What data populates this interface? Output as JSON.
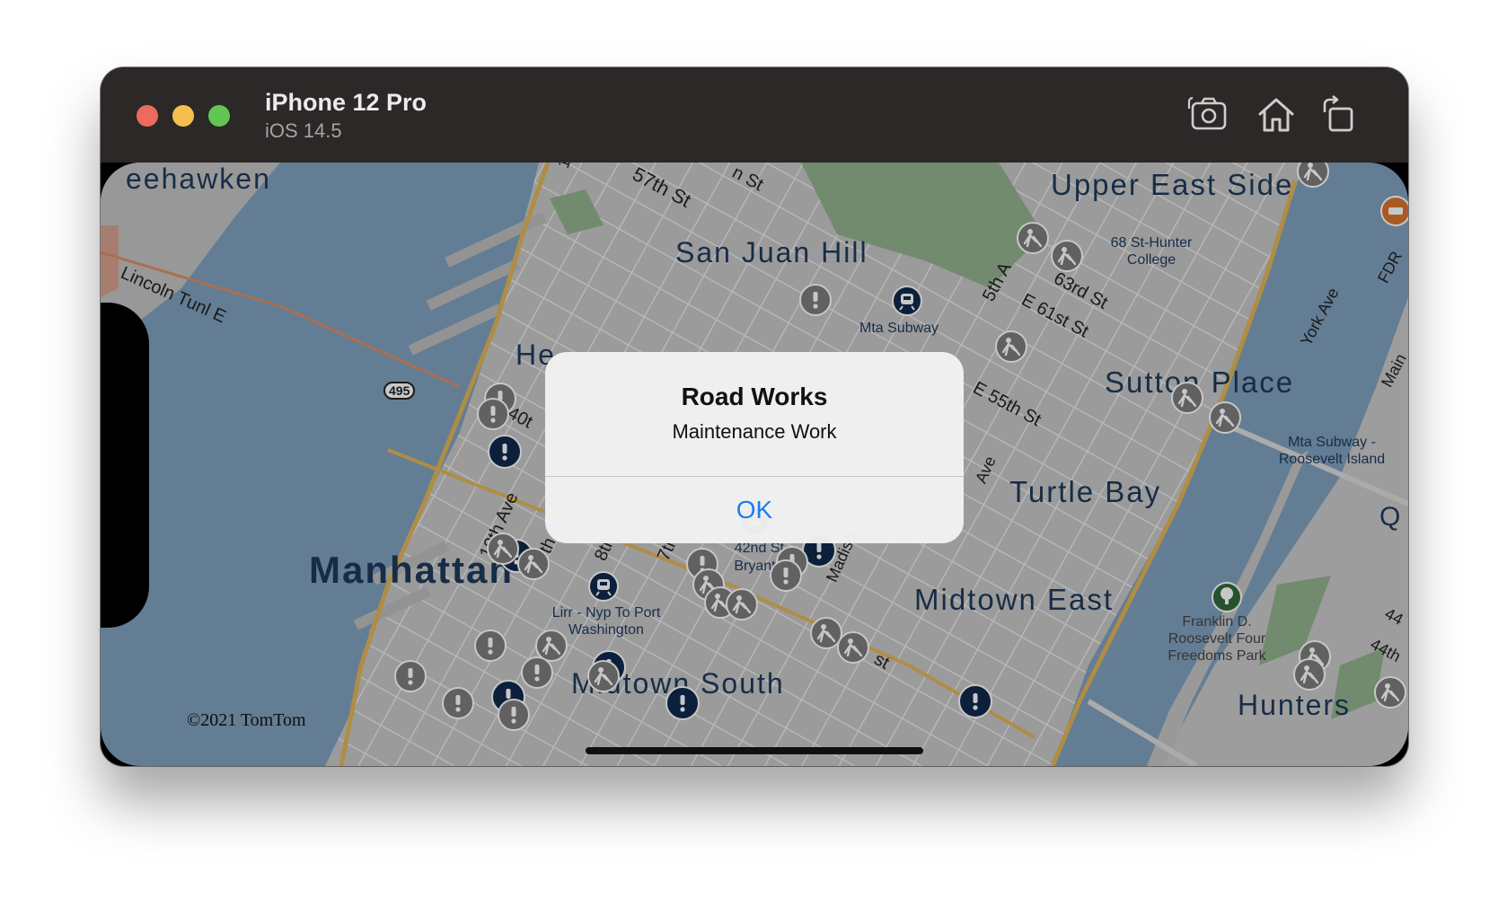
{
  "window": {
    "device_name": "iPhone 12 Pro",
    "os_version": "iOS 14.5"
  },
  "toolbar": {
    "icons": [
      "screenshot-camera-icon",
      "home-icon",
      "rotate-icon"
    ]
  },
  "map": {
    "copyright": "©2021 TomTom",
    "labels": {
      "weehawken": "eehawken",
      "lincoln_tunnel": "Lincoln Tunl E",
      "route_495": "495",
      "st_57th": "57th St",
      "st_12": "12",
      "st_top": "n St",
      "san_juan_hill": "San Juan Hill",
      "upper_east_side": "Upper East Side",
      "hunter_college": "68 St-Hunter College",
      "fifth_ave": "5th A",
      "st_63rd": "63rd St",
      "e_61st": "E 61st St",
      "mta_subway": "Mta Subway",
      "york_ave": "York Ave",
      "fdr": "FDR",
      "main": "Main",
      "hells_kitchen": "He",
      "st_40th": "40t",
      "e_55th": "E 55th St",
      "sutton_place": "Sutton Place",
      "mta_roosevelt": "Mta Subway - Roosevelt Island",
      "turtle_bay": "Turtle Bay",
      "tenth_ave": "10th Ave",
      "ninth_ave": "9th",
      "eighth_ave": "8th",
      "seventh_ave": "7th",
      "bryant_park": "42nd St-Bryant P",
      "madison": "Madiso",
      "lex_ave": "Ave",
      "q_edge": "Q",
      "manhattan": "Manhattan",
      "lirr": "Lirr - Nyp To Port Washington",
      "midtown_east": "Midtown East",
      "fdr_park": "Franklin D. Roosevelt Four Freedoms Park",
      "st_44": "44",
      "st_44th": "44th",
      "midtown_south": "Midtown South",
      "st_bottom": "st",
      "hunters": "Hunters"
    },
    "colors": {
      "water": "#7fa1be",
      "land": "#c6c6c6",
      "park": "#93b28e",
      "highway": "#e1b55a",
      "label": "#1e3a5c",
      "incident_dark": "#10294c",
      "incident_grey": "#7d7d7d"
    }
  },
  "alert": {
    "title": "Road Works",
    "message": "Maintenance Work",
    "ok_label": "OK"
  }
}
